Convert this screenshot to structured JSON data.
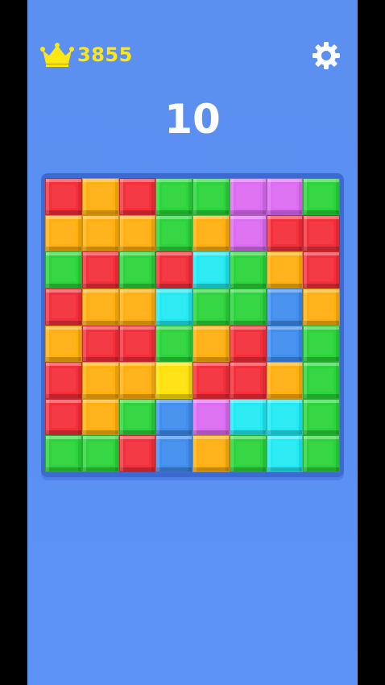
{
  "hud": {
    "best_score": "3855",
    "current_score": "10",
    "icons": {
      "crown": "crown-icon",
      "settings": "gear-icon"
    }
  },
  "colors": {
    "background": "#5b8ff0",
    "board": "#3c6ad1",
    "best_score_text": "#ffe713",
    "score_text": "#ffffff",
    "tiles": {
      "R": "#f42f3a",
      "O": "#ffb00f",
      "G": "#2bd43a",
      "P": "#dc6cf2",
      "C": "#22eaf4",
      "B": "#3f8ef0",
      "Y": "#ffe20a"
    }
  },
  "board": {
    "rows": [
      [
        "R",
        "O",
        "R",
        "G",
        "G",
        "P",
        "P",
        "G"
      ],
      [
        "O",
        "O",
        "O",
        "G",
        "O",
        "P",
        "R",
        "R"
      ],
      [
        "G",
        "R",
        "G",
        "R",
        "C",
        "G",
        "O",
        "R"
      ],
      [
        "R",
        "O",
        "O",
        "C",
        "G",
        "G",
        "B",
        "O"
      ],
      [
        "O",
        "R",
        "R",
        "G",
        "O",
        "R",
        "B",
        "G"
      ],
      [
        "R",
        "O",
        "O",
        "Y",
        "R",
        "R",
        "O",
        "G"
      ],
      [
        "R",
        "O",
        "G",
        "B",
        "P",
        "C",
        "C",
        "G"
      ],
      [
        "G",
        "G",
        "R",
        "B",
        "O",
        "G",
        "C",
        "G"
      ]
    ]
  }
}
